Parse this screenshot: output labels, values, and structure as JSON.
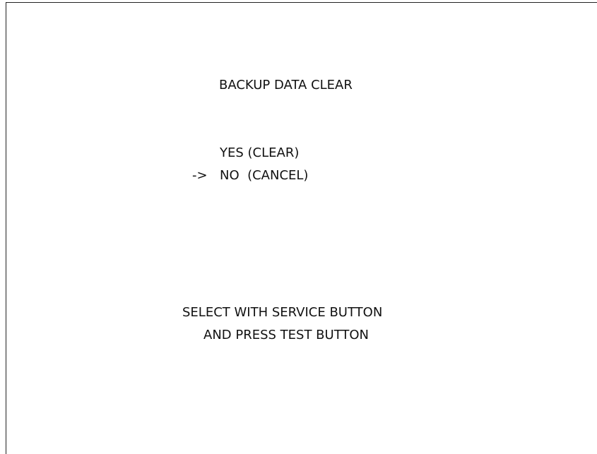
{
  "screen": {
    "title": "BACKUP DATA CLEAR",
    "options": [
      {
        "label": "YES (CLEAR)",
        "selected": false
      },
      {
        "label": "NO  (CANCEL)",
        "selected": true
      }
    ],
    "cursor": "->",
    "instructions": [
      "SELECT WITH SERVICE BUTTON",
      "AND PRESS TEST BUTTON"
    ]
  },
  "colors": {
    "background": "#ffffff",
    "text": "#111111",
    "frame": "#222222"
  }
}
